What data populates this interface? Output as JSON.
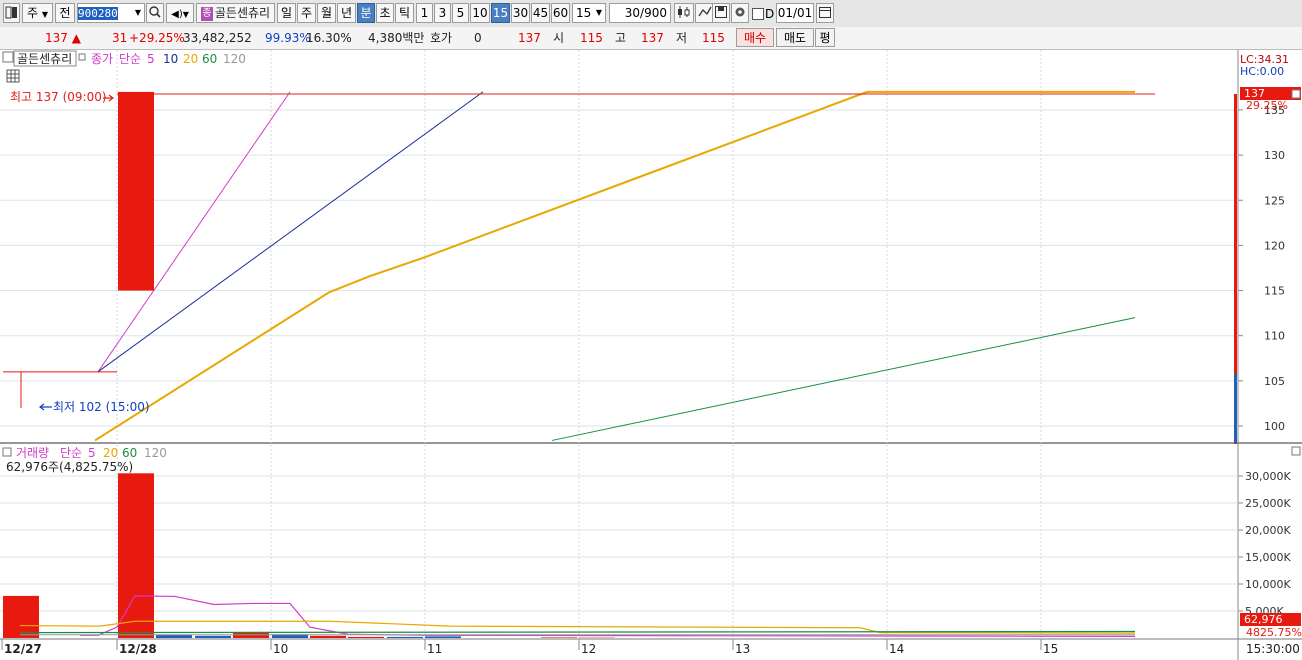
{
  "toolbar": {
    "market_type": "주",
    "adjust_mode": "전",
    "stock_code": "900280",
    "stock_name": "골든센츄리",
    "stock_badge": "종",
    "period_day": "일",
    "period_week": "주",
    "period_month": "월",
    "period_year": "년",
    "period_minute": "분",
    "period_second": "초",
    "period_tick": "틱",
    "interval_1": "1",
    "interval_3": "3",
    "interval_5": "5",
    "interval_10": "10",
    "interval_15": "15",
    "interval_30": "30",
    "interval_45": "45",
    "interval_60": "60",
    "interval_select": "15",
    "bar_count": "30",
    "bar_total": "/900",
    "checkbox_label": "D",
    "date_value": "01/01"
  },
  "quote": {
    "price": "137",
    "change": "31",
    "change_pct": "+29.25%",
    "volume": "33,482,252",
    "vol_ratio": "99.93%",
    "turnover": "16.30%",
    "amount": "4,380백만",
    "hoga_label": "호가",
    "hoga_value": "0",
    "hoga_price": "137",
    "open_label": "시",
    "open_value": "115",
    "high_label": "고",
    "high_value": "137",
    "low_label": "저",
    "low_value": "115",
    "buy_label": "매수",
    "sell_label": "매도",
    "eval_label": "평"
  },
  "price_panel": {
    "tab_label": "골든센츄리",
    "legend_close": "종가",
    "legend_ma_type": "단순",
    "legend_ma": [
      "5",
      "10",
      "20",
      "60",
      "120"
    ],
    "high_marker": "최고 137 (09:00)",
    "low_marker": "최저 102 (15:00)",
    "lc_label": "LC:34.31",
    "hc_label": "HC:0.00",
    "current_price_tag": "137",
    "current_pct_tag": "29.25%"
  },
  "volume_panel": {
    "legend_label": "거래량",
    "legend_ma_type": "단순",
    "legend_ma": [
      "5",
      "20",
      "60",
      "120"
    ],
    "info": "62,976주(4,825.75%)",
    "current_tag": "62,976",
    "current_pct_tag": "4825.75%"
  },
  "time_axis": {
    "labels": [
      "12/27",
      "12/28",
      "10",
      "11",
      "12",
      "13",
      "14",
      "15"
    ],
    "clock": "15:30:00"
  },
  "colors": {
    "up": "#e8190f",
    "down": "#1f5fbf",
    "ma5": "#d03cc8",
    "ma10": "#1a2e9a",
    "ma20": "#e8a800",
    "ma60": "#169040",
    "ma120": "#999999"
  },
  "chart_data": [
    {
      "type": "candlestick",
      "title": "골든센츄리",
      "y_ticks": [
        "100",
        "105",
        "110",
        "115",
        "120",
        "125",
        "130",
        "135"
      ],
      "ylim": [
        98,
        139
      ],
      "x_labels": [
        "12/27",
        "12/28",
        "10",
        "11",
        "12",
        "13",
        "14",
        "15"
      ],
      "bars": [
        {
          "label": "12/27 15:00",
          "open": 106,
          "high": 106,
          "low": 102,
          "close": 106
        },
        {
          "label": "12/28 09:00",
          "open": 115,
          "high": 137,
          "low": 115,
          "close": 137
        }
      ],
      "series": [
        {
          "name": "5",
          "values": [
            106,
            137
          ]
        },
        {
          "name": "10",
          "values": [
            106,
            137
          ]
        },
        {
          "name": "20",
          "values": [
            98,
            137
          ]
        },
        {
          "name": "60",
          "values": [
            98,
            112
          ]
        }
      ]
    },
    {
      "type": "bar",
      "title": "거래량",
      "y_ticks": [
        "5,000K",
        "10,000K",
        "15,000K",
        "20,000K",
        "25,000K",
        "30,000K"
      ],
      "ylim": [
        0,
        33000
      ],
      "values": [
        7800,
        30500,
        600,
        400,
        1100,
        700,
        400,
        200,
        200,
        300,
        100,
        63
      ]
    }
  ]
}
